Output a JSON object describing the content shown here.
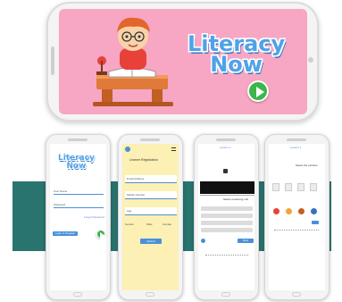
{
  "app": {
    "logo_word1": "Literacy",
    "logo_word2": "Now"
  },
  "screens": {
    "login": {
      "username_placeholder": "User Name",
      "password_placeholder": "Password",
      "forgot_link": "Forgot Password",
      "signin_label": "Login or Register"
    },
    "register": {
      "title": "Learner Registration",
      "email_placeholder": "Email Address",
      "mobile_placeholder": "Mobile Number",
      "age_placeholder": "Age",
      "gender_label": "Gender",
      "male_label": "Male",
      "female_label": "Female",
      "submit_label": "Submit"
    },
    "lesson": {
      "title": "Lesson 1",
      "section_label": "Select a learning unit",
      "next_label": "Next"
    },
    "activity": {
      "title": "Lesson 1",
      "prompt": "Select the pictures"
    }
  },
  "colors": {
    "pink": "#f7a6c4",
    "teal": "#2a7470",
    "logo_blue": "#4fa2e8",
    "play_green": "#3cb54a",
    "register_yellow": "#fcf0b4"
  }
}
